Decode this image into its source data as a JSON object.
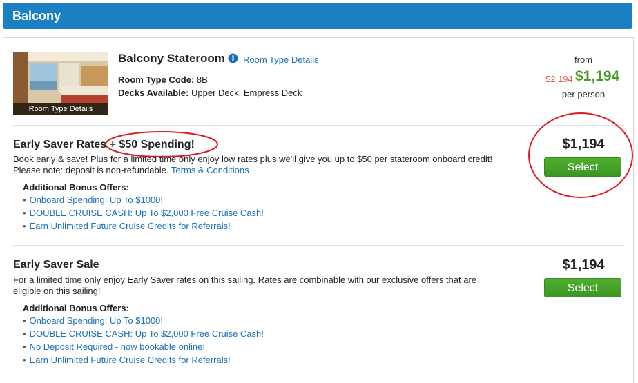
{
  "header": {
    "title": "Balcony"
  },
  "room": {
    "name": "Balcony Stateroom",
    "details_link": "Room Type Details",
    "thumb_caption": "Room Type Details",
    "code_label": "Room Type Code:",
    "code_value": "8B",
    "decks_label": "Decks Available:",
    "decks_value": "Upper Deck, Empress Deck",
    "from_label": "from",
    "old_price": "$2,194",
    "new_price": "$1,194",
    "per_person": "per person"
  },
  "offers": [
    {
      "title": "Early Saver Rates + $50 Spending!",
      "desc": "Book early & save! Plus for a limited time only enjoy low rates plus we'll give you up to $50 per stateroom onboard credit! Please note: deposit is non-refundable.",
      "desc_link": "Terms & Conditions",
      "bonus_title": "Additional Bonus Offers:",
      "bonus": [
        "Onboard Spending: Up To $1000!",
        "DOUBLE CRUISE CASH: Up To $2,000 Free Cruise Cash!",
        "Earn Unlimited Future Cruise Credits for Referrals!"
      ],
      "price": "$1,194",
      "button": "Select"
    },
    {
      "title": "Early Saver Sale",
      "desc": "For a limited time only enjoy Early Saver rates on this sailing. Rates are combinable with our exclusive offers that are eligible on this sailing!",
      "bonus_title": "Additional Bonus Offers:",
      "bonus": [
        "Onboard Spending: Up To $1000!",
        "DOUBLE CRUISE CASH: Up To $2,000 Free Cruise Cash!",
        "No Deposit Required - now bookable online!",
        "Earn Unlimited Future Cruise Credits for Referrals!"
      ],
      "price": "$1,194",
      "button": "Select"
    }
  ],
  "colors": {
    "header": "#1b7fc3",
    "link": "#1b70b8",
    "price_green": "#4a9a2b",
    "strike_red": "#d9534f",
    "annotation": "#e0191d",
    "button": "#4fb030"
  },
  "icons": {
    "info": "info-icon"
  }
}
